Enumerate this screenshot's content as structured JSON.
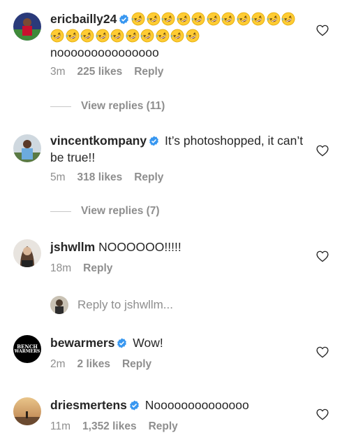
{
  "comments": [
    {
      "username": "ericbailly24",
      "verified": true,
      "text": "nooooooooooooooo",
      "emoji_count": 21,
      "time": "3m",
      "likes": "225 likes",
      "reply": "Reply"
    },
    {
      "username": "vincentkompany",
      "verified": true,
      "text": "It’s photoshopped, it can’t be true!!",
      "time": "5m",
      "likes": "318 likes",
      "reply": "Reply"
    },
    {
      "username": "jshwllm",
      "verified": false,
      "text": "NOOOOOO!!!!!",
      "time": "18m",
      "reply": "Reply"
    },
    {
      "username": "bewarmers",
      "verified": true,
      "text": "Wow!",
      "time": "2m",
      "likes": "2 likes",
      "reply": "Reply"
    },
    {
      "username": "driesmertens",
      "verified": true,
      "text": "Noooooooooooooo",
      "time": "11m",
      "likes": "1,352 likes",
      "reply": "Reply"
    }
  ],
  "view_replies": [
    "View replies (11)",
    "View replies (7)"
  ],
  "reply_to": "Reply to jshwllm...",
  "bench_warmers_logo": {
    "line1": "BENCH",
    "line2": "WARMERS"
  },
  "colors": {
    "verified": "#3897f0",
    "muted": "#8e8e8e",
    "text": "#262626"
  },
  "icons": [
    "rofl-emoji-icon",
    "verified-badge-icon",
    "heart-icon"
  ]
}
